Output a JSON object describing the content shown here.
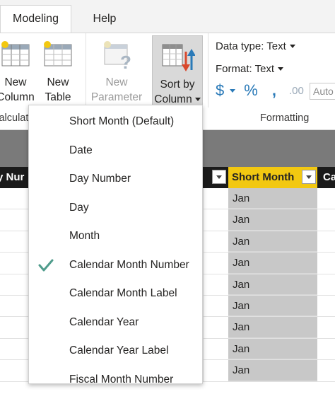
{
  "tabs": {
    "modeling": "Modeling",
    "help": "Help"
  },
  "ribbon": {
    "new_column": [
      "New",
      "Column"
    ],
    "new_table": [
      "New",
      "Table"
    ],
    "new_parameter": [
      "New",
      "Parameter"
    ],
    "sort_by_column": [
      "Sort by",
      "Column"
    ],
    "calculations_label": "Calculatio",
    "data_type": "Data type: Text",
    "format": "Format: Text",
    "currency_symbol": "$",
    "percent_symbol": "%",
    "comma_symbol": ",",
    "decimal_symbol": ".00",
    "auto_label": "Auto",
    "formatting_label": "Formatting"
  },
  "table": {
    "left_header": "y Nur",
    "short_month_header": "Short Month",
    "right_header": "Ca",
    "short_month_values": [
      "Jan",
      "Jan",
      "Jan",
      "Jan",
      "Jan",
      "Jan",
      "Jan",
      "Jan",
      "Jan"
    ]
  },
  "sort_menu": {
    "items": [
      {
        "label": "Short Month (Default)",
        "checked": false
      },
      {
        "label": "Date",
        "checked": false
      },
      {
        "label": "Day Number",
        "checked": false
      },
      {
        "label": "Day",
        "checked": false
      },
      {
        "label": "Month",
        "checked": false
      },
      {
        "label": "Calendar Month Number",
        "checked": true
      },
      {
        "label": "Calendar Month Label",
        "checked": false
      },
      {
        "label": "Calendar Year",
        "checked": false
      },
      {
        "label": "Calendar Year Label",
        "checked": false
      },
      {
        "label": "Fiscal Month Number",
        "checked": false
      }
    ]
  },
  "colors": {
    "accent_yellow": "#f2c811",
    "check_green": "#4f9c8c",
    "sort_arrow_red": "#d9482c",
    "sort_arrow_blue": "#2a7ab8"
  }
}
